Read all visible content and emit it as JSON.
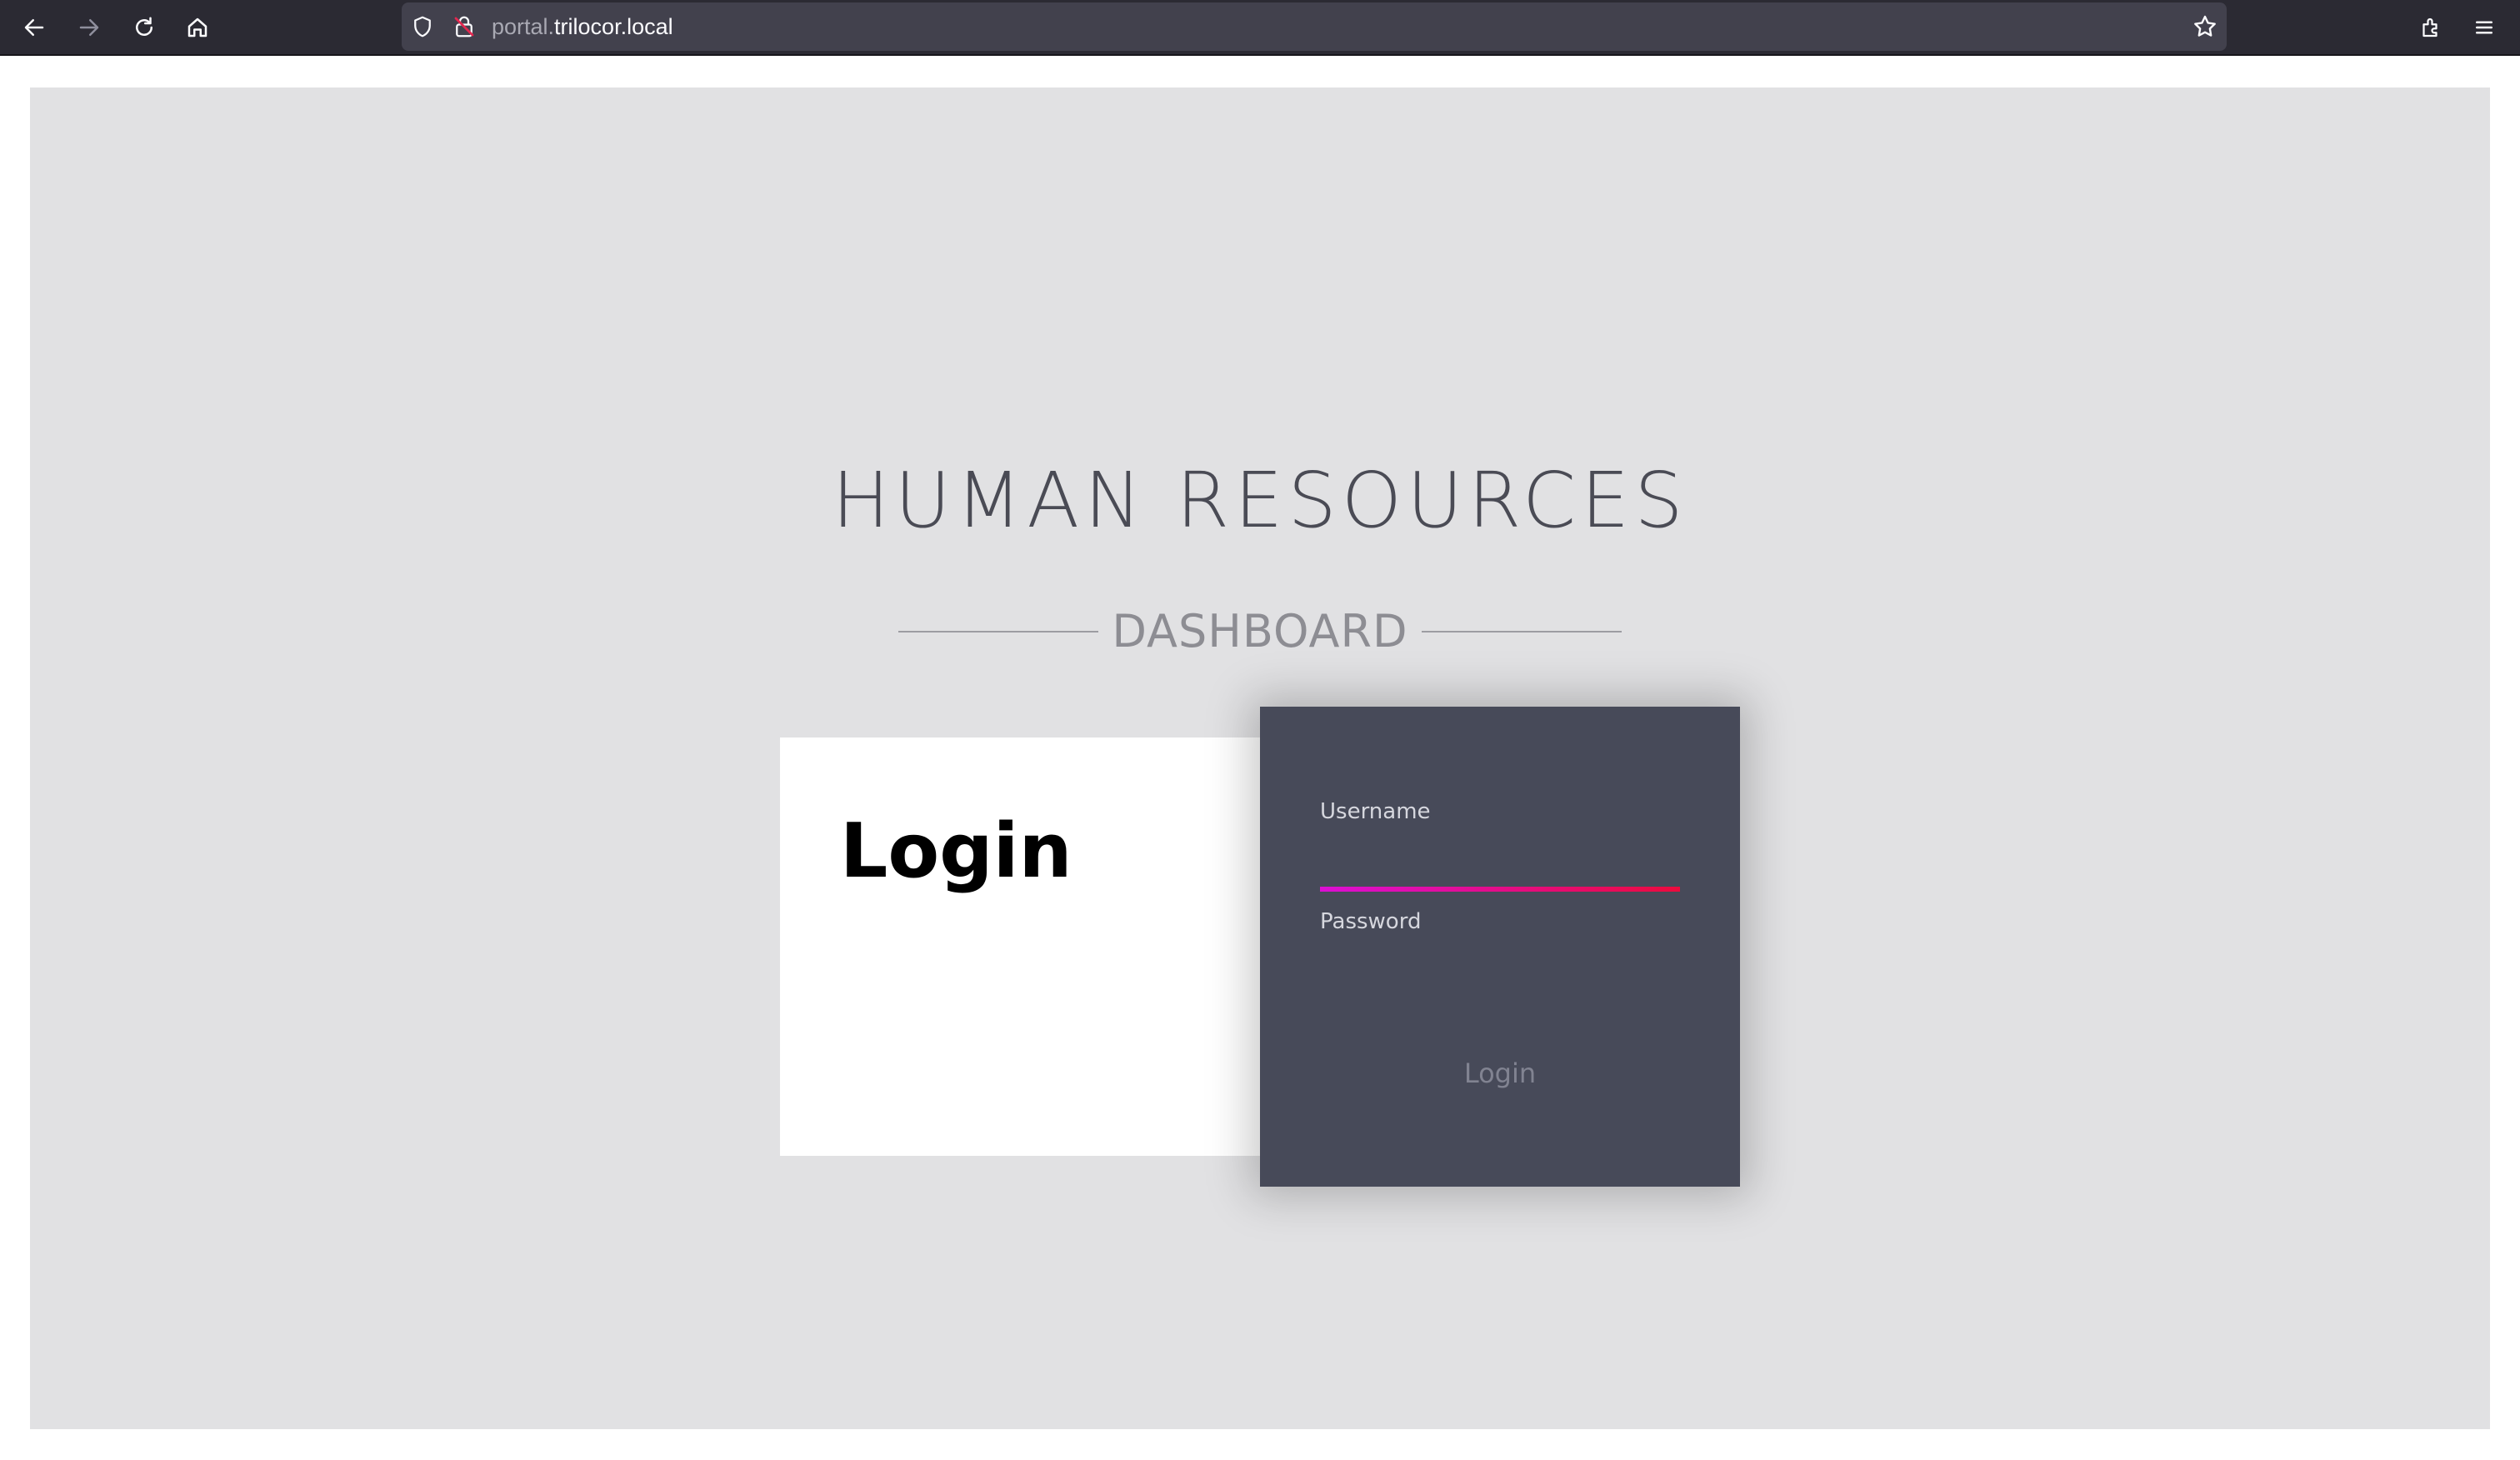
{
  "browser": {
    "url_prefix": "portal.",
    "url_domain": "trilocor.local",
    "nav_icons": [
      "back-arrow-icon",
      "forward-arrow-icon",
      "reload-icon",
      "home-icon"
    ],
    "url_icons": [
      "shield-icon",
      "insecure-lock-icon",
      "bookmark-star-icon"
    ],
    "right_icons": [
      "extensions-icon",
      "menu-icon"
    ]
  },
  "page": {
    "title": "HUMAN RESOURCES",
    "subtitle": "DASHBOARD",
    "background_color": "#e1e1e3"
  },
  "login_card": {
    "heading": "Login"
  },
  "login_form": {
    "username_label": "Username",
    "username_value": "",
    "password_label": "Password",
    "password_value": "",
    "submit_label": "Login",
    "panel_color": "#474a59",
    "focus_gradient": [
      "#dc0fd4",
      "#ec0b3d"
    ]
  }
}
